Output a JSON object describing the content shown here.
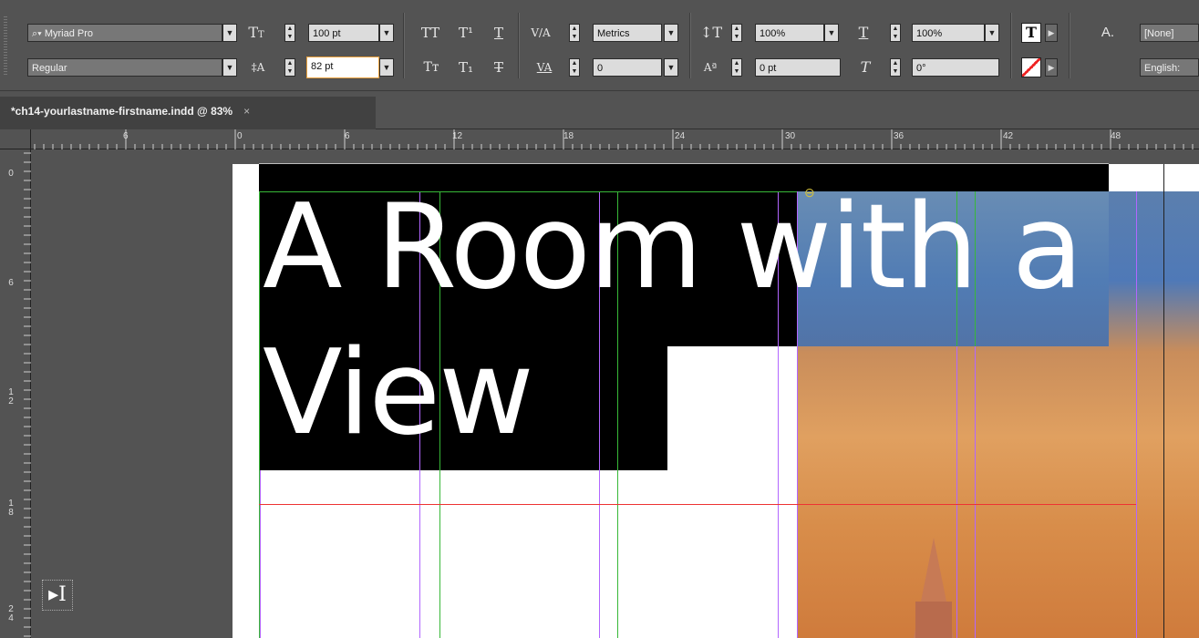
{
  "control_panel": {
    "font_family": "Myriad Pro",
    "font_style": "Regular",
    "font_size": "100 pt",
    "leading": "82 pt",
    "kerning": "Metrics",
    "tracking": "0",
    "vertical_scale": "100%",
    "horizontal_scale": "100%",
    "baseline_shift": "0 pt",
    "skew": "0°",
    "char_style": "[None]",
    "language": "English:"
  },
  "document_tab": {
    "title": "*ch14-yourlastname-firstname.indd @ 83%",
    "close": "×"
  },
  "ruler_h": [
    "6",
    "0",
    "6",
    "12",
    "18",
    "24",
    "30",
    "36",
    "42",
    "48"
  ],
  "ruler_v": [
    "0",
    "6",
    "1\n2",
    "1\n8",
    "2\n4"
  ],
  "document": {
    "headline": "A Room with a View"
  }
}
